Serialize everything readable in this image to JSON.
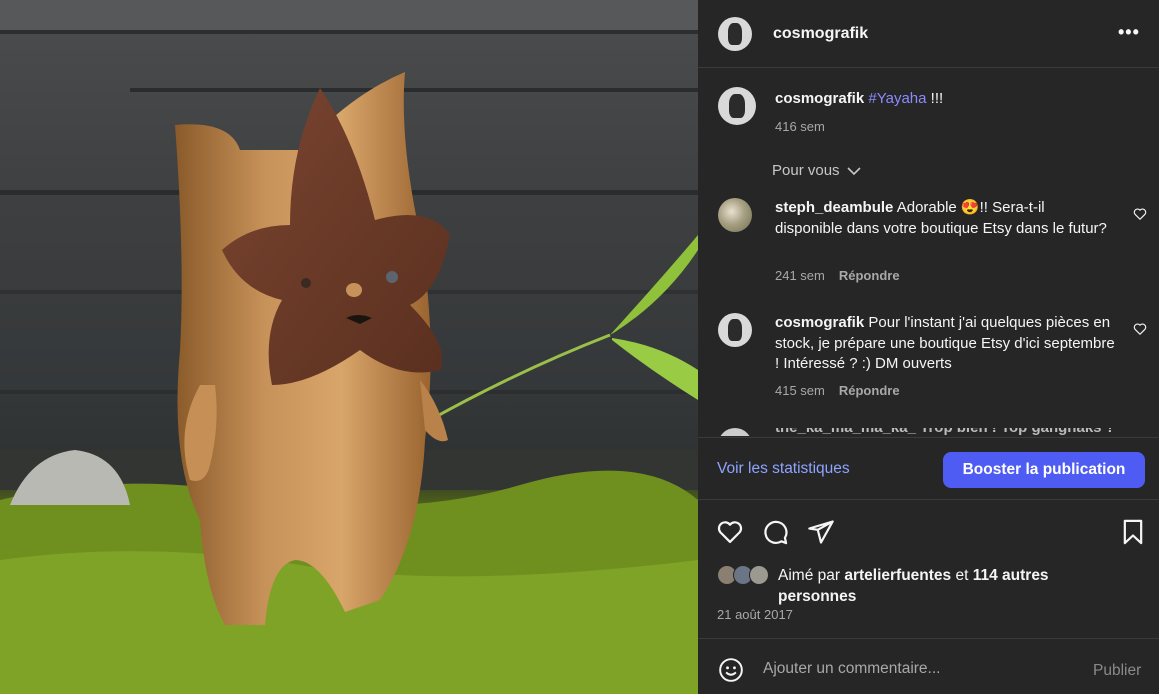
{
  "post": {
    "author": "cosmografik",
    "caption": {
      "username": "cosmografik",
      "hashtag": "#Yayaha",
      "suffix": " !!!",
      "time": "416 sem"
    }
  },
  "comments_header": {
    "filter_label": "Pour vous"
  },
  "comments": [
    {
      "username": "steph_deambule",
      "text": "Adorable 😍!! Sera-t-il disponible dans votre boutique Etsy dans le futur?",
      "time": "241 sem",
      "reply_label": "Répondre"
    },
    {
      "username": "cosmografik",
      "text": "Pour l'instant j'ai quelques pièces en stock, je prépare une boutique Etsy d'ici septembre ! Intéressé ? :) DM ouverts",
      "time": "415 sem",
      "reply_label": "Répondre"
    }
  ],
  "cutoff_comment": {
    "text": "the_ka_ma_ma_ka_ Trop bien ! Top gangnaks ?"
  },
  "insights": {
    "stats_label": "Voir les statistiques",
    "boost_label": "Booster la publication"
  },
  "likes": {
    "prefix": "Aimé par ",
    "user": "artelierfuentes",
    "middle": " et ",
    "count": "114 autres personnes"
  },
  "date": "21 août 2017",
  "add_comment": {
    "placeholder": "Ajouter un commentaire...",
    "publish_label": "Publier"
  },
  "colors": {
    "panel_bg": "#262626",
    "accent": "#4f5cf3",
    "link": "#8ea4ff",
    "hashtag": "#8b8bff"
  },
  "icons": [
    "more-icon",
    "heart-icon",
    "comment-icon",
    "share-icon",
    "bookmark-icon",
    "emoji-icon",
    "chevron-down-icon"
  ]
}
